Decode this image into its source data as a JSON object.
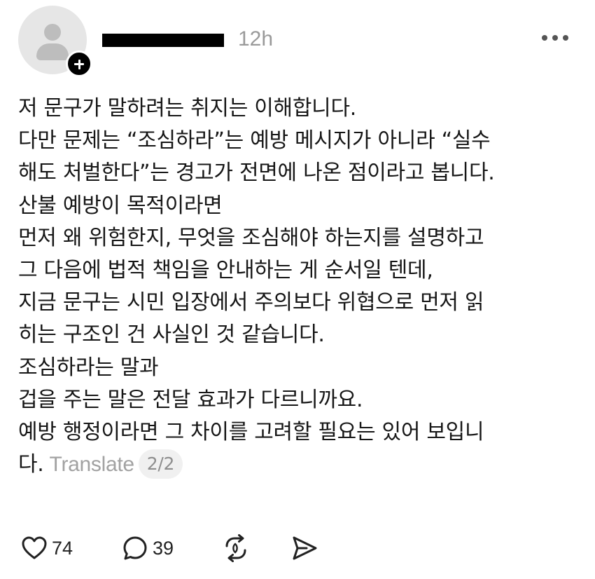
{
  "post": {
    "timestamp": "12h",
    "body_lines": [
      "저 문구가 말하려는 취지는 이해합니다.",
      "다만 문제는 “조심하라”는 예방 메시지가 아니라 “실수",
      "해도 처벌한다”는 경고가 전면에 나온 점이라고 봅니다.",
      "산불 예방이 목적이라면",
      "먼저 왜 위험한지, 무엇을 조심해야 하는지를 설명하고",
      "그 다음에 법적 책임을 안내하는 게 순서일 텐데,",
      "지금 문구는 시민 입장에서 주의보다 위협으로 먼저 읽",
      "히는 구조인 건 사실인 것 같습니다.",
      "조심하라는 말과",
      "겁을 주는 말은 전달 효과가 다르니까요.",
      "예방 행정이라면 그 차이를 고려할 필요는 있어 보입니"
    ],
    "last_line_text": "다.",
    "translate_label": "Translate",
    "page_indicator": "2/2"
  },
  "actions": {
    "likes": "74",
    "replies": "39"
  },
  "icons": {
    "avatar": "default-avatar-icon",
    "follow": "plus-icon",
    "more": "more-horizontal-icon",
    "like": "heart-icon",
    "reply": "comment-icon",
    "repost": "repost-icon",
    "share": "send-icon"
  }
}
